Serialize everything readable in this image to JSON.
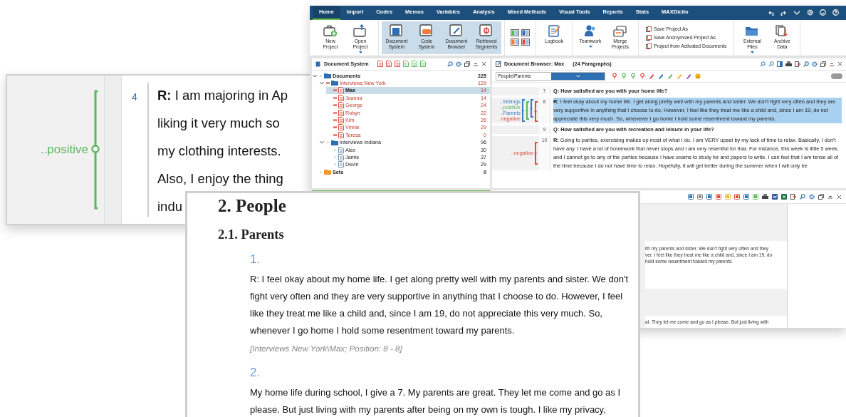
{
  "zoom_inset": {
    "code_label": "..positive",
    "line_number": "4",
    "lines": [
      "**R:** I am majoring in Ap",
      "liking it very much so",
      "my clothing interests.",
      "Also, I enjoy the thing",
      "indu"
    ]
  },
  "app": {
    "ribbon_tabs": [
      {
        "label": "Home",
        "selected": true
      },
      {
        "label": "Import",
        "selected": false
      },
      {
        "label": "Codes",
        "selected": false
      },
      {
        "label": "Memos",
        "selected": false
      },
      {
        "label": "Variables",
        "selected": false
      },
      {
        "label": "Analysis",
        "selected": false
      },
      {
        "label": "Mixed Methods",
        "selected": false
      },
      {
        "label": "Visual Tools",
        "selected": false
      },
      {
        "label": "Reports",
        "selected": false
      },
      {
        "label": "Stats",
        "selected": false
      },
      {
        "label": "MAXDictio",
        "selected": false
      }
    ],
    "ribbon_groups": [
      {
        "buttons": [
          {
            "label": "New Project"
          },
          {
            "label": "Open Project",
            "dropdown": true
          }
        ]
      },
      {
        "highlighted": true,
        "buttons": [
          {
            "label": "Document System"
          },
          {
            "label": "Code System"
          },
          {
            "label": "Document Browser"
          },
          {
            "label": "Retrieved Segments"
          }
        ]
      },
      {
        "layouts": true
      },
      {
        "buttons": [
          {
            "label": "Logbook"
          }
        ]
      },
      {
        "buttons": [
          {
            "label": "Teamwork",
            "dropdown": true
          },
          {
            "label": "Merge Projects"
          }
        ]
      },
      {
        "list": [
          "Save Project As",
          "Save Anonymized Project As",
          "Project from Activated Documents"
        ]
      },
      {
        "buttons": [
          {
            "label": "External Files",
            "dropdown": true
          },
          {
            "label": "Archive Data"
          }
        ]
      }
    ]
  },
  "document_system": {
    "title": "Document System",
    "tree": [
      {
        "label": "Documents",
        "count": "225",
        "kind": "folder",
        "expanded": true,
        "activated": false,
        "selected": false,
        "children": [
          {
            "label": "Interviews New York",
            "count": "129",
            "kind": "folder",
            "expanded": true,
            "activated": true,
            "selected": false,
            "children": [
              {
                "label": "Max",
                "count": "14",
                "kind": "document",
                "activated": true,
                "selected": true
              },
              {
                "label": "Joanna",
                "count": "14",
                "kind": "document",
                "activated": true,
                "selected": false
              },
              {
                "label": "George",
                "count": "24",
                "kind": "document",
                "activated": true,
                "selected": false
              },
              {
                "label": "Robyn",
                "count": "22",
                "kind": "document",
                "activated": true,
                "selected": false
              },
              {
                "label": "Kim",
                "count": "26",
                "kind": "document",
                "activated": true,
                "selected": false
              },
              {
                "label": "Vinnie",
                "count": "29",
                "kind": "document",
                "activated": true,
                "selected": false
              },
              {
                "label": "Teresa",
                "count": "0",
                "kind": "document",
                "activated": true,
                "selected": false
              }
            ]
          },
          {
            "label": "Interviews Indiana",
            "count": "96",
            "kind": "folder",
            "expanded": true,
            "activated": false,
            "selected": false,
            "children": [
              {
                "label": "Alex",
                "count": "30",
                "kind": "document",
                "activated": false,
                "selected": false
              },
              {
                "label": "Jamie",
                "count": "37",
                "kind": "document",
                "activated": false,
                "selected": false
              },
              {
                "label": "Devin",
                "count": "29",
                "kind": "document",
                "activated": false,
                "selected": false
              }
            ]
          }
        ]
      },
      {
        "label": "Sets",
        "count": "0",
        "kind": "set",
        "activated": false,
        "selected": false
      }
    ]
  },
  "document_browser": {
    "title": "Document Browser: Max",
    "paragraph_count": "(24 Paragraphs)",
    "code_field": {
      "value": "People\\Parents"
    },
    "edit_toggle": {
      "on": false
    },
    "paragraphs": [
      {
        "number": "7",
        "kind": "question",
        "selected": false,
        "text": "Q: How satisfied are you with your home life?"
      },
      {
        "number": "8",
        "kind": "answer",
        "selected": true,
        "text": "**R:** I feel okay about my home life. I get along pretty well with my parents and sister. We don't fight very often and they are very supportive in anything that I choose to do. However, I feel like they treat me like a child and, since I am 19, do not appreciate this very much. So, whenever I go home I hold some resentment toward my parents.",
        "codes": [
          {
            "label": "..Siblings",
            "color": "#3a7dbf"
          },
          {
            "label": "..positive",
            "color": "#5cb85c"
          },
          {
            "label": "..Parents",
            "color": "#3a7dbf"
          },
          {
            "label": "..negative",
            "color": "#e04a3f"
          }
        ]
      },
      {
        "number": "9",
        "kind": "question",
        "selected": false,
        "text": "Q: How satisfied are you with recreation and leisure in your life?"
      },
      {
        "number": "10",
        "kind": "answer",
        "selected": false,
        "text": "**R:** Going to parties, exercising makes up most of what I do. I am VERY upset by my lack of time to relax. Basically, I don't have any. I have a lot of homework that never stops and I am very resentful for that. For instance, this week is little 5 week, and I cannot go to any of the parties because I have exams to study for and papers to write. I can feel that I am tense all of the time because I do not have time to relax. Hopefully, it will get better during the summer when I will only be",
        "codes": [
          {
            "label": "..negative",
            "color": "#e04a3f"
          }
        ]
      }
    ]
  },
  "retrieved_segments": {
    "lines": [
      "ith my parents and sister. We don't fight very often and they",
      "ver, I feel like they treat me like a child and, since I am 19, do",
      "hold some resentment toward my parents."
    ],
    "next_lines": [
      "at. They let me come and go as I please. But just living with"
    ]
  },
  "export_document": {
    "heading": "2. People",
    "subheading": "2.1. Parents",
    "segments": [
      {
        "number": "1.",
        "text": "R: I feel okay about my home life. I get along pretty well with my parents and sister. We don't fight very often and they are very supportive in anything that I choose to do. However, I feel like they treat me like a child and, since I am 19, do not appreciate this very much. So, whenever I go home I hold some resentment toward my parents.",
        "source": "[Interviews New York\\Max; Position: 8 - 8]"
      },
      {
        "number": "2.",
        "text": "My home life during school, I give a 7. My parents are great. They let me come and go as I please. But just living with my parents after being on my own is tough. I like my privacy,"
      }
    ]
  }
}
